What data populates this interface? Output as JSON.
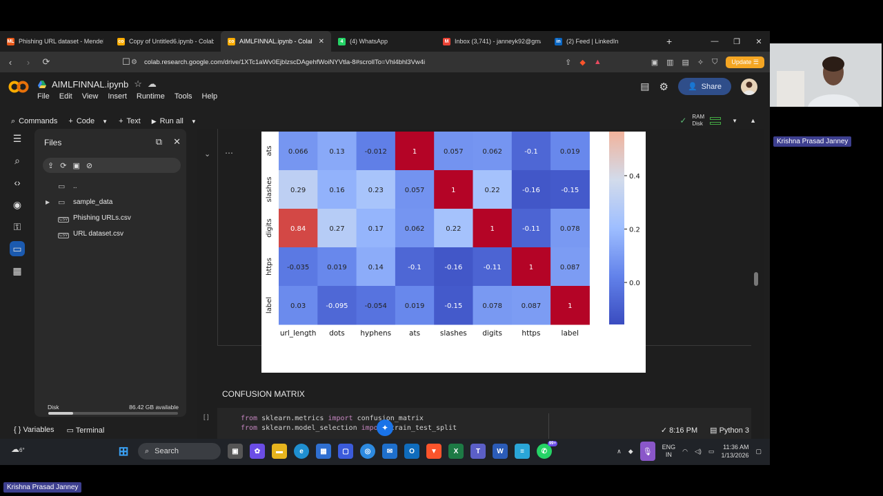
{
  "browser": {
    "tabs": [
      {
        "label": "Phishing URL dataset - Mendele",
        "fav_color": "#e8591a",
        "fav_text": "ML"
      },
      {
        "label": "Copy of Untitled6.ipynb - Colab",
        "fav_color": "#f9ab00",
        "fav_text": "co"
      },
      {
        "label": "AIMLFINNAL.ipynb - Colab",
        "fav_color": "#f9ab00",
        "fav_text": "co",
        "active": true
      },
      {
        "label": "(4) WhatsApp",
        "fav_color": "#25d366",
        "fav_text": "4"
      },
      {
        "label": "Inbox (3,741) - janneyk92@gma",
        "fav_color": "#ea4335",
        "fav_text": "M"
      },
      {
        "label": "(2) Feed | LinkedIn",
        "fav_color": "#0a66c2",
        "fav_text": "in"
      }
    ],
    "url": "colab.research.google.com/drive/1XTc1aWv0EjblzscDAgehfWoiNYVtla-8#scrollTo=Vhl4bhl3Vw4i",
    "update_label": "Update"
  },
  "colab": {
    "notebook_title": "AIMLFINNAL.ipynb",
    "menu": [
      "File",
      "Edit",
      "View",
      "Insert",
      "Runtime",
      "Tools",
      "Help"
    ],
    "share_label": "Share",
    "toolbar": {
      "commands": "Commands",
      "code": "Code",
      "text": "Text",
      "run_all": "Run all"
    },
    "ram_label": "RAM",
    "disk_label": "Disk"
  },
  "files_panel": {
    "title": "Files",
    "items": [
      {
        "name": "..",
        "type": "folder",
        "expandable": false
      },
      {
        "name": "sample_data",
        "type": "folder",
        "expandable": true
      },
      {
        "name": "Phishing URLs.csv",
        "type": "csv",
        "expandable": false
      },
      {
        "name": "URL dataset.csv",
        "type": "csv",
        "expandable": false
      }
    ],
    "disk_label": "Disk",
    "disk_available": "86.42 GB available",
    "disk_used_fraction": 0.19
  },
  "chart_data": {
    "type": "heatmap",
    "rows": [
      "ats",
      "slashes",
      "digits",
      "https",
      "label"
    ],
    "columns": [
      "url_length",
      "dots",
      "hyphens",
      "ats",
      "slashes",
      "digits",
      "https",
      "label"
    ],
    "values": [
      [
        0.066,
        0.13,
        -0.012,
        1,
        0.057,
        0.062,
        -0.1,
        0.019
      ],
      [
        0.29,
        0.16,
        0.23,
        0.057,
        1,
        0.22,
        -0.16,
        -0.15
      ],
      [
        0.84,
        0.27,
        0.17,
        0.062,
        0.22,
        1,
        -0.11,
        0.078
      ],
      [
        -0.035,
        0.019,
        0.14,
        -0.1,
        -0.16,
        -0.11,
        1,
        0.087
      ],
      [
        0.03,
        -0.095,
        -0.054,
        0.019,
        -0.15,
        0.078,
        0.087,
        1
      ]
    ],
    "value_labels": [
      [
        "0.066",
        "0.13",
        "-0.012",
        "1",
        "0.057",
        "0.062",
        "-0.1",
        "0.019"
      ],
      [
        "0.29",
        "0.16",
        "0.23",
        "0.057",
        "1",
        "0.22",
        "-0.16",
        "-0.15"
      ],
      [
        "0.84",
        "0.27",
        "0.17",
        "0.062",
        "0.22",
        "1",
        "-0.11",
        "0.078"
      ],
      [
        "-0.035",
        "0.019",
        "0.14",
        "-0.1",
        "-0.16",
        "-0.11",
        "1",
        "0.087"
      ],
      [
        "0.03",
        "-0.095",
        "-0.054",
        "0.019",
        "-0.15",
        "0.078",
        "0.087",
        "1"
      ]
    ],
    "colormap": "coolwarm",
    "colorbar_ticks": [
      0.4,
      0.2,
      0.0
    ],
    "colorbar_tick_labels": [
      "0.4",
      "0.2",
      "0.0"
    ]
  },
  "notebook": {
    "section_title": "CONFUSION MATRIX",
    "cell_bracket": "[ ]",
    "code_lines": [
      {
        "kw1": "from",
        "mod": " sklearn.metrics ",
        "kw2": "import",
        "name": " confusion_matrix"
      },
      {
        "kw1": "from",
        "mod": " sklearn.model_selection ",
        "kw2": "import",
        "name": " train_test_split"
      }
    ]
  },
  "status": {
    "variables": "Variables",
    "terminal": "Terminal",
    "time": "8:16 PM",
    "runtime": "Python 3"
  },
  "taskbar": {
    "search": "Search",
    "weather": "6°",
    "lang_top": "ENG",
    "lang_bottom": "IN",
    "clock_time": "11:36 AM",
    "clock_date": "1/13/2026",
    "badge": "99+"
  },
  "call": {
    "participant_name": "Krishna Prasad Janney",
    "self_name": "Krishna Prasad Janney"
  }
}
